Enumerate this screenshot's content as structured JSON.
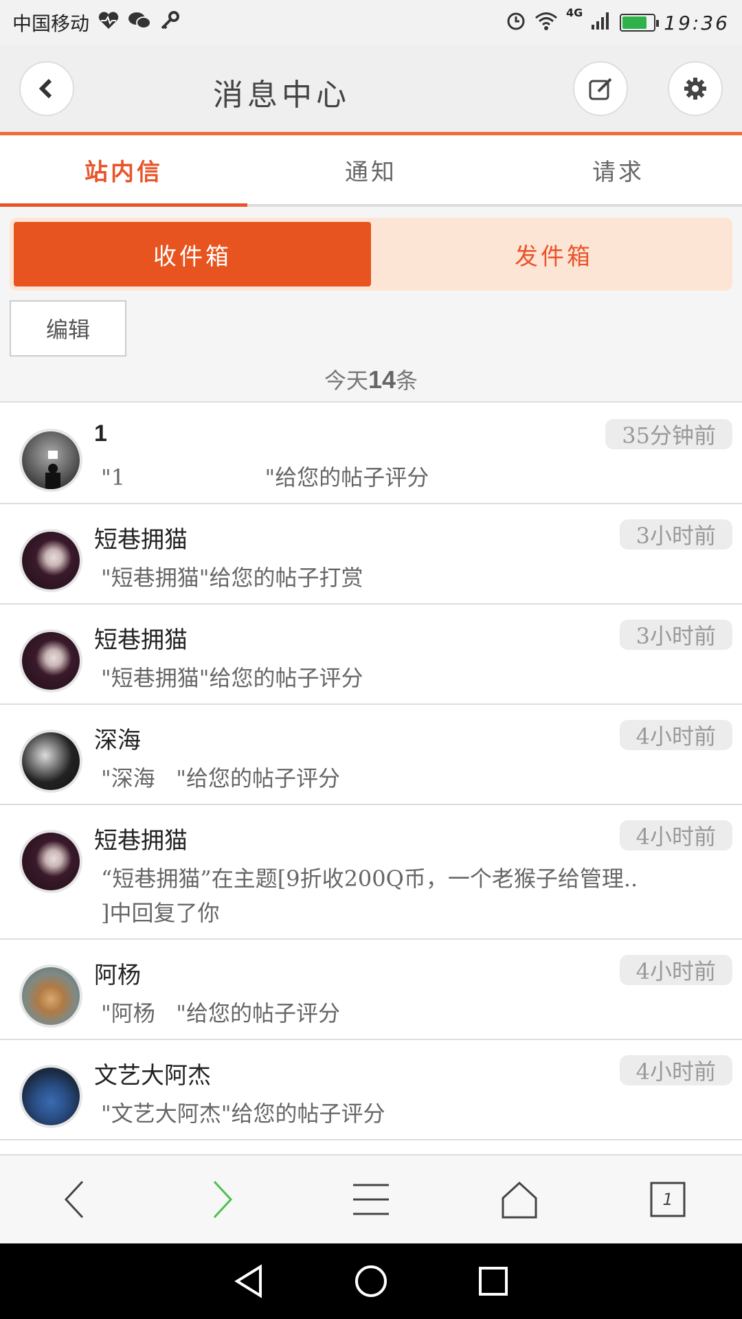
{
  "status": {
    "carrier": "中国移动",
    "network": "4G",
    "time": "19:36"
  },
  "header": {
    "title": "消息中心"
  },
  "tabs": [
    {
      "label": "站内信"
    },
    {
      "label": "通知"
    },
    {
      "label": "请求"
    }
  ],
  "mailbox": {
    "inbox": "收件箱",
    "outbox": "发件箱",
    "edit": "编辑",
    "count_prefix": "今天",
    "count": "14",
    "count_suffix": "条"
  },
  "messages": [
    {
      "name": "1",
      "time": "35分钟前",
      "text": "\"1                    \"给您的帖子评分"
    },
    {
      "name": "短巷拥猫",
      "time": "3小时前",
      "text": "\"短巷拥猫\"给您的帖子打赏"
    },
    {
      "name": "短巷拥猫",
      "time": "3小时前",
      "text": "\"短巷拥猫\"给您的帖子评分"
    },
    {
      "name": "深海",
      "time": "4小时前",
      "text": "\"深海   \"给您的帖子评分"
    },
    {
      "name": "短巷拥猫",
      "time": "4小时前",
      "text": "“短巷拥猫”在主题[9折收200Q币，一个老猴子给管理..\n]中回复了你"
    },
    {
      "name": "阿杨",
      "time": "4小时前",
      "text": "\"阿杨   \"给您的帖子评分"
    },
    {
      "name": "文艺大阿杰",
      "time": "4小时前",
      "text": "\"文艺大阿杰\"给您的帖子评分"
    }
  ],
  "browser": {
    "tab_count": "1"
  },
  "colors": {
    "accent": "#e8542a",
    "accent_light": "#fde5d6",
    "forward_green": "#4cc04a"
  }
}
